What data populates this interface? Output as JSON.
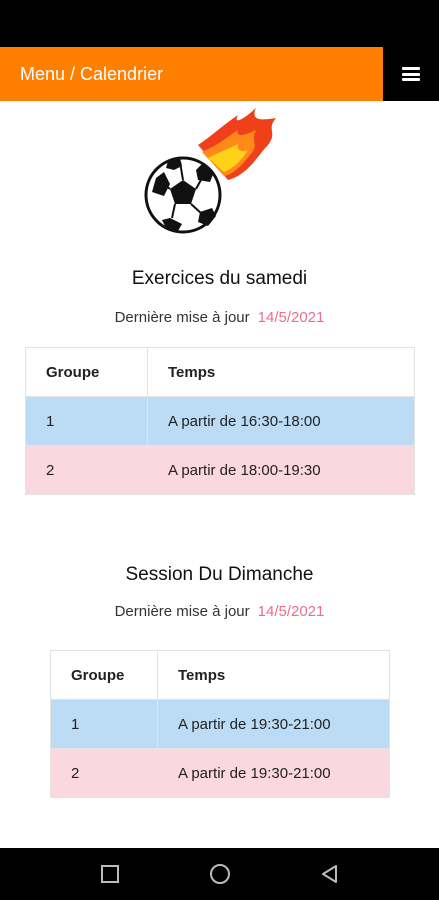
{
  "header": {
    "title": "Menu / Calendrier",
    "accent": "#ff8000"
  },
  "sections": [
    {
      "title": "Exercices du samedi",
      "update_label": "Dernière mise à jour",
      "update_date": "14/5/2021",
      "columns": [
        "Groupe",
        "Temps"
      ],
      "rows": [
        {
          "group": "1",
          "time": "A partir de 16:30-18:00"
        },
        {
          "group": "2",
          "time": "A partir de 18:00-19:30"
        }
      ]
    },
    {
      "title": "Session Du Dimanche",
      "update_label": "Dernière mise à jour",
      "update_date": "14/5/2021",
      "columns": [
        "Groupe",
        "Temps"
      ],
      "rows": [
        {
          "group": "1",
          "time": "A partir de 19:30-21:00"
        },
        {
          "group": "2",
          "time": "A partir de 19:30-21:00"
        }
      ]
    }
  ],
  "colors": {
    "row_blue": "#bcdcf5",
    "row_pink": "#fbd7df",
    "date": "#ee6c8c"
  },
  "icons": {
    "menu": "hamburger-icon",
    "logo": "flaming-soccer-ball-icon",
    "nav": [
      "square-icon",
      "circle-icon",
      "triangle-back-icon"
    ]
  }
}
